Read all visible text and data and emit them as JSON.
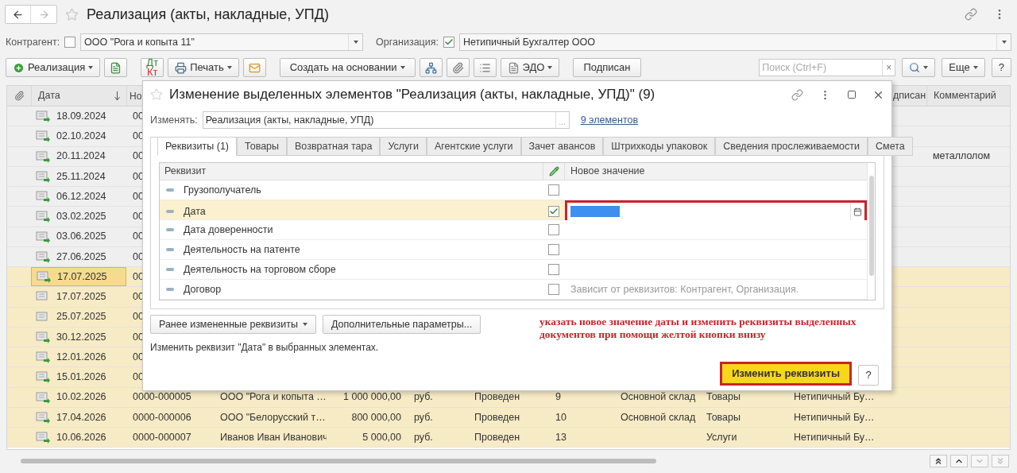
{
  "window": {
    "title": "Реализация (акты, накладные, УПД)"
  },
  "filters": [
    {
      "label": "Контрагент:",
      "checked": false,
      "value": "ООО \"Рога и копыта 11\""
    },
    {
      "label": "Организация:",
      "checked": true,
      "value": "Нетипичный Бухгалтер ООО"
    }
  ],
  "toolbar": [
    {
      "kind": "create",
      "label": "Реализация"
    },
    {
      "kind": "doc"
    },
    {
      "kind": "dtkt",
      "label": "Дт",
      "sublabel": "Кт"
    },
    {
      "kind": "print",
      "label": "Печать"
    },
    {
      "kind": "mail"
    },
    {
      "kind": "menu",
      "label": "Создать на основании"
    },
    {
      "kind": "structure"
    },
    {
      "kind": "clip"
    },
    {
      "kind": "list"
    },
    {
      "kind": "edo",
      "label": "ЭДО"
    },
    {
      "kind": "button",
      "label": "Подписан"
    }
  ],
  "search": {
    "placeholder": "Поиск (Ctrl+F)",
    "clear": "×"
  },
  "toolbar_right": [
    {
      "kind": "search"
    },
    {
      "kind": "menu",
      "label": "Еще"
    },
    {
      "kind": "help",
      "label": "?"
    }
  ],
  "table": {
    "header": {
      "date": "Дата",
      "number": "Но",
      "signed": "дписан",
      "comment": "Комментарий"
    },
    "rows": [
      {
        "date": "18.09.2024",
        "number": "00",
        "posted": true,
        "selected": false,
        "current": false
      },
      {
        "date": "02.10.2024",
        "number": "00",
        "posted": true,
        "selected": false,
        "current": false
      },
      {
        "date": "20.11.2024",
        "number": "00",
        "posted": true,
        "selected": false,
        "current": false,
        "comment": "металлолом"
      },
      {
        "date": "25.11.2024",
        "number": "00",
        "posted": true,
        "selected": false,
        "current": false
      },
      {
        "date": "06.12.2024",
        "number": "00",
        "posted": true,
        "selected": false,
        "current": false
      },
      {
        "date": "03.02.2025",
        "number": "00",
        "posted": true,
        "selected": false,
        "current": false
      },
      {
        "date": "03.06.2025",
        "number": "00",
        "posted": true,
        "selected": false,
        "current": false
      },
      {
        "date": "27.06.2025",
        "number": "00",
        "posted": true,
        "selected": false,
        "current": false
      },
      {
        "date": "17.07.2025",
        "number": "00",
        "posted": true,
        "selected": true,
        "current": true
      },
      {
        "date": "17.07.2025",
        "number": "00",
        "posted": false,
        "selected": true,
        "current": false
      },
      {
        "date": "25.07.2025",
        "number": "00",
        "posted": false,
        "selected": true,
        "current": false
      },
      {
        "date": "30.12.2025",
        "number": "00",
        "posted": true,
        "selected": true,
        "current": false
      },
      {
        "date": "12.01.2026",
        "number": "00",
        "posted": true,
        "selected": true,
        "current": false
      },
      {
        "date": "15.01.2026",
        "number": "00",
        "posted": true,
        "selected": true,
        "current": false
      },
      {
        "date": "10.02.2026",
        "number": "0000-000005",
        "contractor": "ООО \"Рога и копыта …",
        "amount": "1 000 000,00",
        "currency": "руб.",
        "status": "Проведен",
        "column_8": "9",
        "warehouse": "Основной склад",
        "operation": "Товары",
        "organization": "Нетипичный Бу…",
        "posted": true,
        "selected": true,
        "current": false
      },
      {
        "date": "17.04.2026",
        "number": "0000-000006",
        "contractor": "ООО \"Белорусский т…",
        "amount": "800 000,00",
        "currency": "руб.",
        "status": "Проведен",
        "column_8": "10",
        "warehouse": "Основной склад",
        "operation": "Товары",
        "organization": "Нетипичный Бу…",
        "posted": true,
        "selected": true,
        "current": false
      },
      {
        "date": "10.06.2026",
        "number": "0000-000007",
        "contractor": "Иванов Иван Иванович",
        "amount": "5 000,00",
        "currency": "руб.",
        "status": "Проведен",
        "column_8": "13",
        "operation": "Услуги",
        "organization": "Нетипичный Бу…",
        "posted": true,
        "selected": true,
        "current": false
      }
    ]
  },
  "pager": [
    {
      "kind": "first",
      "disabled": false
    },
    {
      "kind": "up",
      "disabled": false
    },
    {
      "kind": "down",
      "disabled": true
    },
    {
      "kind": "last",
      "disabled": true
    }
  ],
  "dialog": {
    "title": "Изменение выделенных элементов \"Реализация (акты, накладные, УПД)\" (9)",
    "change_label": "Изменять:",
    "change_value": "Реализация (акты, накладные, УПД)",
    "select_button": "...",
    "count_link": "9 элементов",
    "tabs": [
      {
        "label": "Реквизиты (1)",
        "selected": true
      },
      {
        "label": "Товары",
        "selected": false
      },
      {
        "label": "Возвратная тара",
        "selected": false
      },
      {
        "label": "Услуги",
        "selected": false
      },
      {
        "label": "Агентские услуги",
        "selected": false
      },
      {
        "label": "Зачет авансов",
        "selected": false
      },
      {
        "label": "Штрихкоды упаковок",
        "selected": false
      },
      {
        "label": "Сведения прослеживаемости",
        "selected": false
      },
      {
        "label": "Смета",
        "selected": false
      }
    ],
    "grid": {
      "columns": [
        "Реквизит",
        "Новое значение"
      ],
      "rows": [
        {
          "name": "Грузополучатель",
          "checked": false,
          "selected": false,
          "editing": false
        },
        {
          "name": "Дата",
          "checked": true,
          "selected": true,
          "editing": true
        },
        {
          "name": "Дата доверенности",
          "checked": false,
          "selected": false,
          "editing": false
        },
        {
          "name": "Деятельность на патенте",
          "checked": false,
          "selected": false,
          "editing": false
        },
        {
          "name": "Деятельность на торговом сборе",
          "checked": false,
          "selected": false,
          "editing": false
        },
        {
          "name": "Договор",
          "checked": false,
          "selected": false,
          "editing": false,
          "hint": "Зависит от реквизитов: Контрагент, Организация."
        }
      ]
    },
    "buttons": [
      {
        "label": "Ранее измененные реквизиты",
        "dropdown": true
      },
      {
        "label": "Дополнительные параметры...",
        "dropdown": false
      }
    ],
    "status": "Изменить реквизит \"Дата\" в выбранных элементах.",
    "annotation": "указать новое значение даты и изменить реквизиты выделенных документов при помощи желтой кнопки внизу",
    "primary_button": "Изменить реквизиты",
    "help_button": "?"
  }
}
